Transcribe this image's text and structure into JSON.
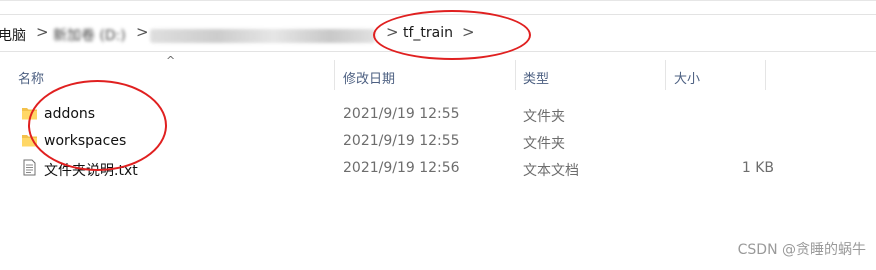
{
  "breadcrumb": {
    "items": [
      "电脑",
      "新加卷 (D:)",
      "tf_train"
    ],
    "separator": ">"
  },
  "columns": [
    "名称",
    "修改日期",
    "类型",
    "大小"
  ],
  "files": [
    {
      "name": "addons",
      "modified": "2021/9/19 12:55",
      "type": "文件夹",
      "size": "",
      "icon": "folder-icon"
    },
    {
      "name": "workspaces",
      "modified": "2021/9/19 12:55",
      "type": "文件夹",
      "size": "",
      "icon": "folder-icon"
    },
    {
      "name": "文件夹说明.txt",
      "modified": "2021/9/19 12:56",
      "type": "文本文档",
      "size": "1 KB",
      "icon": "text-file-icon"
    }
  ],
  "watermark": "CSDN @贪睡的蜗牛",
  "colors": {
    "annotation": "#e02020",
    "folder": "#f3c14b",
    "header_text": "#4d6082"
  }
}
